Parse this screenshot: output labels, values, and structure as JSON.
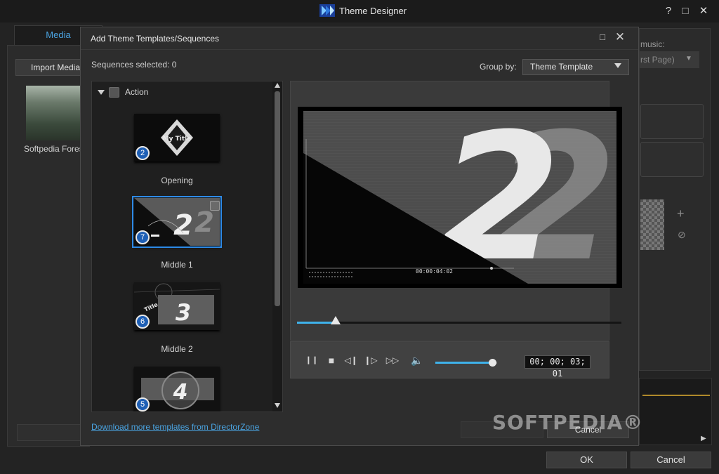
{
  "app": {
    "title": "Theme Designer",
    "help_glyph": "?",
    "maximize_glyph": "□",
    "close_glyph": "✕",
    "minimize_glyph": "—"
  },
  "background": {
    "media_tab": "Media",
    "import_button": "Import Media",
    "thumbnail_label": "Softpedia Forest",
    "music_label": "music:",
    "page_select": "rst Page)",
    "plus_glyph": "+",
    "ban_glyph": "⊘",
    "scroll_right_glyph": "▶",
    "ok_button": "OK",
    "cancel_button": "Cancel"
  },
  "dialog": {
    "title": "Add Theme Templates/Sequences",
    "max_glyph": "□",
    "close_glyph": "✕",
    "sequences_selected": "Sequences selected: 0",
    "group_by_label": "Group by:",
    "group_by_value": "Theme Template",
    "group": {
      "name": "Action",
      "templates": [
        {
          "name": "Opening",
          "count": "2",
          "thumb_text": "My Title"
        },
        {
          "name": "Middle 1",
          "count": "7",
          "thumb_text": "2"
        },
        {
          "name": "Middle 2",
          "count": "6",
          "thumb_text": "3"
        },
        {
          "name": "",
          "count": "5",
          "thumb_text": "4"
        }
      ]
    },
    "preview": {
      "big_number": "2",
      "timecode": "00:00:04:02",
      "time_display": "00; 00; 03; 01",
      "scrub_progress": 0.12,
      "volume_level": 0.92
    },
    "controls": {
      "pause_glyph": "❙❙",
      "stop_glyph": "■",
      "prev_frame_glyph": "◁❙",
      "next_frame_glyph": "❙▷",
      "fast_forward_glyph": "▷▷",
      "volume_glyph": "🔈"
    },
    "download_link": "Download more templates from DirectorZone",
    "cancel_button": "Cancel",
    "watermark": "SOFTPEDIA®"
  },
  "colors": {
    "accent": "#3fb2ea",
    "link": "#4aa3e0",
    "selection": "#2e8ae6",
    "badge": "#1e5fb5"
  }
}
